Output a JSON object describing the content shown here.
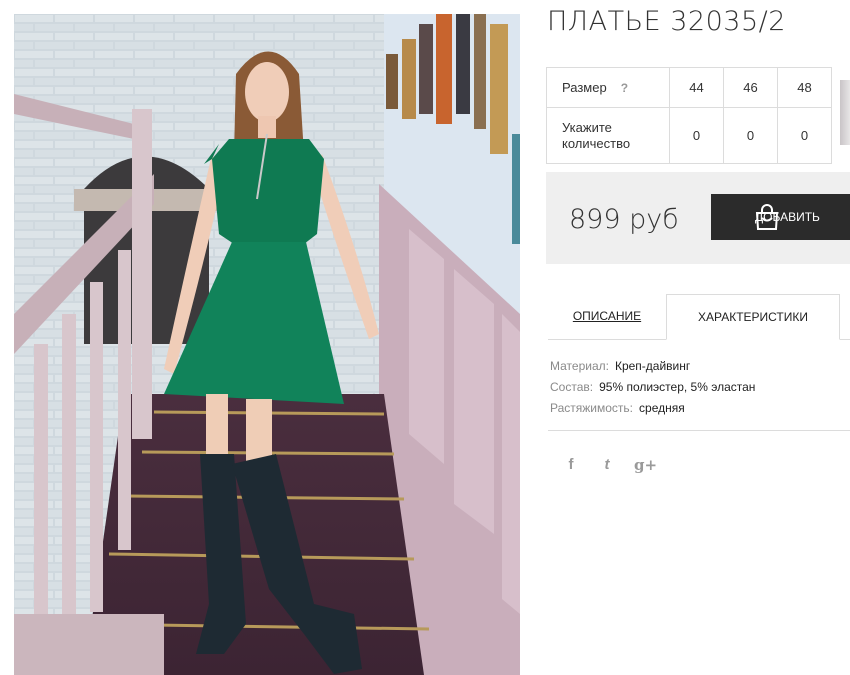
{
  "product": {
    "title": "ПЛАТЬЕ 32035/2",
    "image_alt": "Green dress with zipper, worn with dark suede over-knee boots on a staircase"
  },
  "size_table": {
    "size_label": "Размер",
    "help_icon": "?",
    "sizes": [
      "44",
      "46",
      "48"
    ],
    "qty_label_line1": "Укажите",
    "qty_label_line2": "количество",
    "quantities": [
      "0",
      "0",
      "0"
    ]
  },
  "purchase": {
    "price": "899 руб",
    "add_button_label": "ДОБАВИТЬ"
  },
  "tabs": {
    "description": "ОПИСАНИЕ",
    "characteristics": "ХАРАКТЕРИСТИКИ",
    "active": "characteristics"
  },
  "specs": [
    {
      "key": "Материал:",
      "value": "Креп-дайвинг"
    },
    {
      "key": "Состав:",
      "value": "95% полиэстер, 5% эластан"
    },
    {
      "key": "Растяжимость:",
      "value": "средняя"
    }
  ],
  "social": [
    {
      "icon": "facebook-icon",
      "glyph": "f"
    },
    {
      "icon": "twitter-icon",
      "glyph": "t"
    },
    {
      "icon": "google-plus-icon",
      "glyph": "g+"
    }
  ],
  "colors": {
    "dress_green": "#0f7a52",
    "button_dark": "#2b2b2b",
    "price_box_bg": "#efefef"
  }
}
